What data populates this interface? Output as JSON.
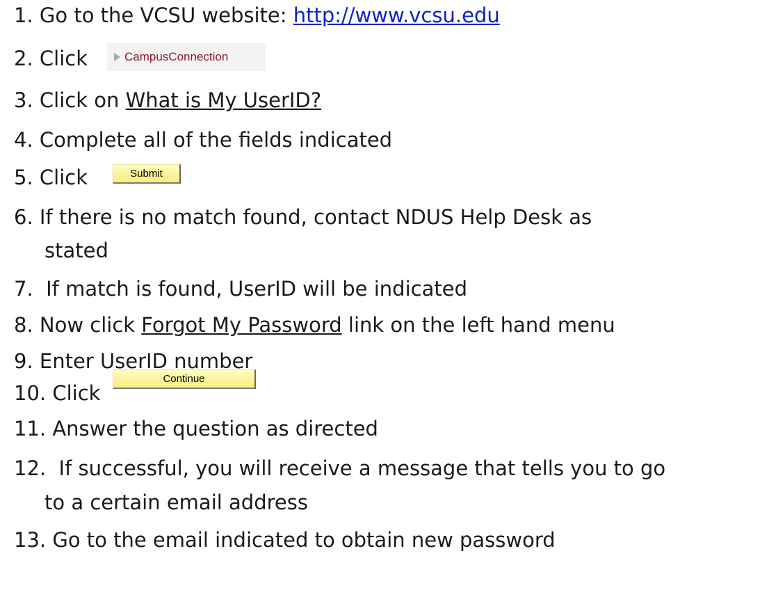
{
  "steps": {
    "s1": {
      "num": "1.",
      "text": "Go to the VCSU website: ",
      "link": "http://www.vcsu.edu"
    },
    "s2": {
      "num": "2.",
      "text": "Click",
      "button": "CampusConnection"
    },
    "s3": {
      "num": "3.",
      "text": "Click on ",
      "link": "What is My UserID?"
    },
    "s4": {
      "num": "4.",
      "text": "Complete all of the fields indicated"
    },
    "s5": {
      "num": "5.",
      "text": "Click",
      "button": "Submit"
    },
    "s6": {
      "num": "6.",
      "text": "If there is no match found, contact NDUS Help Desk as",
      "cont": "stated"
    },
    "s7": {
      "num": "7.",
      "text": " If match is found, UserID will be indicated"
    },
    "s8": {
      "num": "8.",
      "text_before": "Now click ",
      "link": "Forgot My Password",
      "text_after": " link on the left hand menu"
    },
    "s9": {
      "num": "9.",
      "text": "Enter UserID number"
    },
    "s10": {
      "num": "10.",
      "text": "Click",
      "button": "Continue"
    },
    "s11": {
      "num": "11.",
      "text": "Answer the question as directed"
    },
    "s12": {
      "num": "12.",
      "text": " If successful, you will receive a message that tells you to go",
      "cont": "to a certain email address"
    },
    "s13": {
      "num": "13.",
      "text": "Go to the email indicated to obtain new password"
    }
  },
  "colors": {
    "link": "#0b22c9",
    "campus_text": "#8b1c2b",
    "button_fill": "#f7ed7d"
  },
  "icons": {
    "campus_arrow": "triangle-right-icon"
  }
}
